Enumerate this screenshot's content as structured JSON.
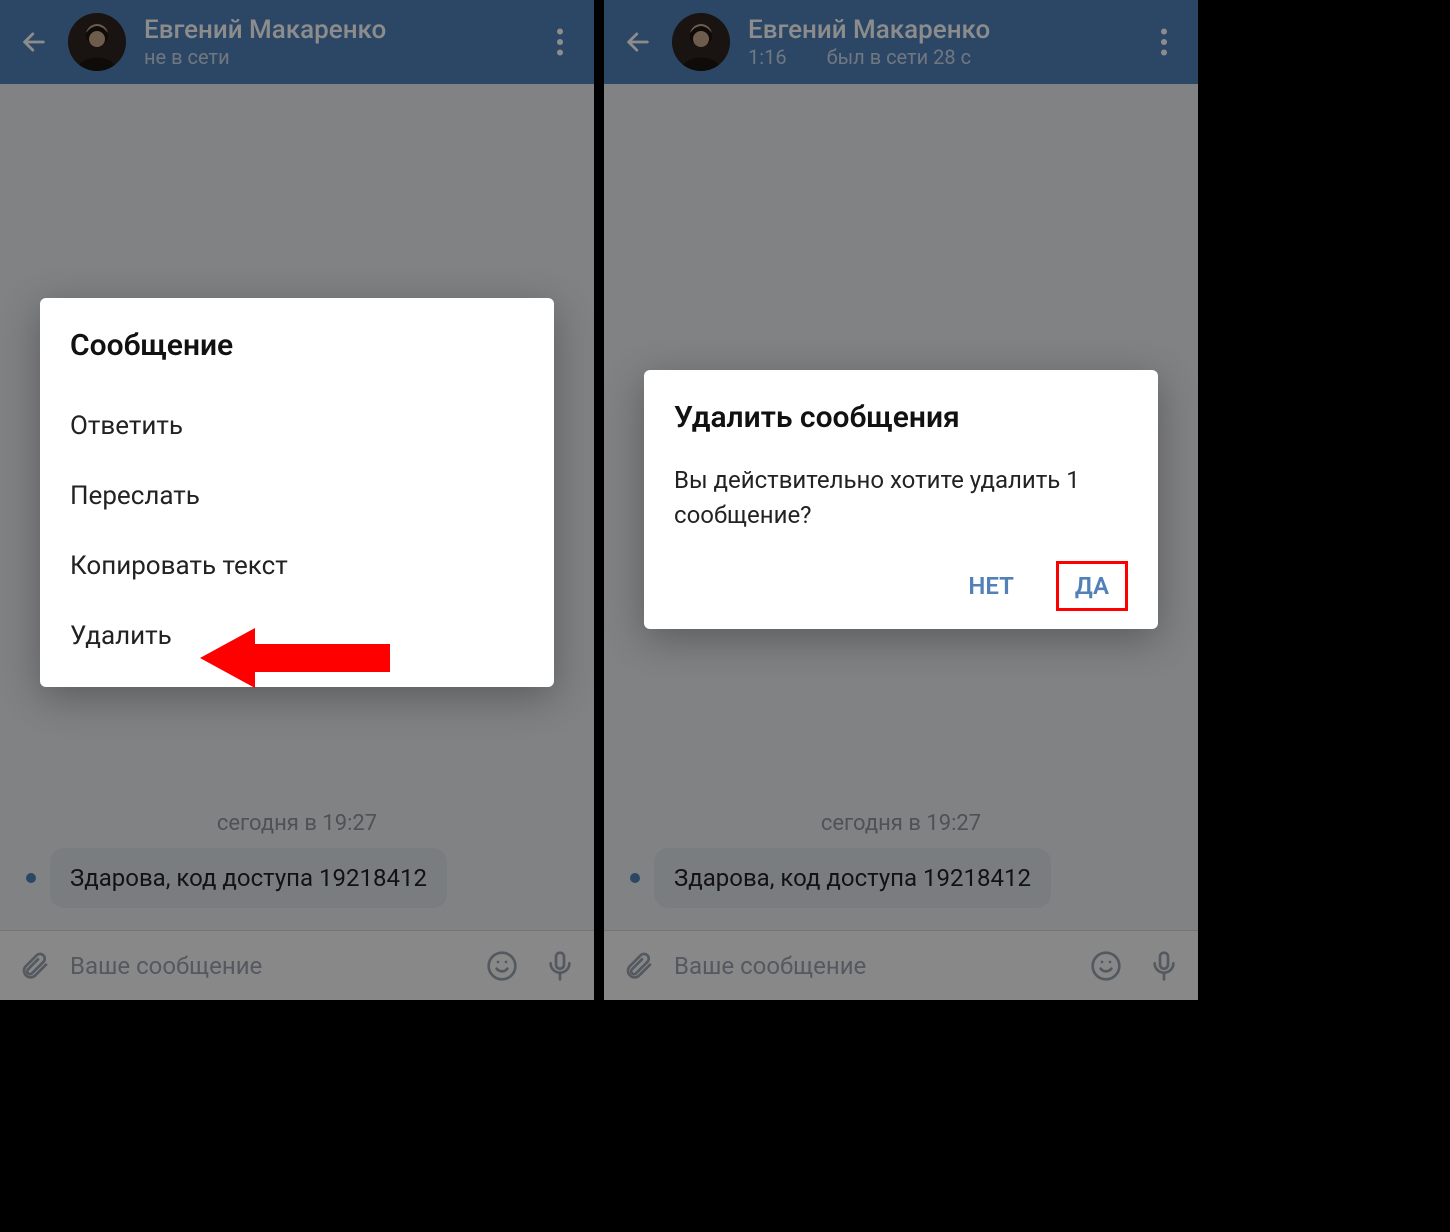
{
  "left": {
    "header": {
      "name": "Евгений Макаренко",
      "status": "не в сети"
    },
    "date_separator": "сегодня в 19:27",
    "message_text": "Здарова, код доступа 19218412",
    "input_placeholder": "Ваше сообщение",
    "dialog": {
      "title": "Сообщение",
      "items": [
        "Ответить",
        "Переслать",
        "Копировать текст",
        "Удалить"
      ]
    }
  },
  "right": {
    "header": {
      "name": "Евгений Макаренко",
      "time": "1:16",
      "status": "был в сети 28 с"
    },
    "date_separator": "сегодня в 19:27",
    "message_text": "Здарова, код доступа 19218412",
    "input_placeholder": "Ваше сообщение",
    "dialog": {
      "title": "Удалить сообщения",
      "body": "Вы действительно хотите удалить 1 сообщение?",
      "no": "НЕТ",
      "yes": "ДА"
    }
  }
}
